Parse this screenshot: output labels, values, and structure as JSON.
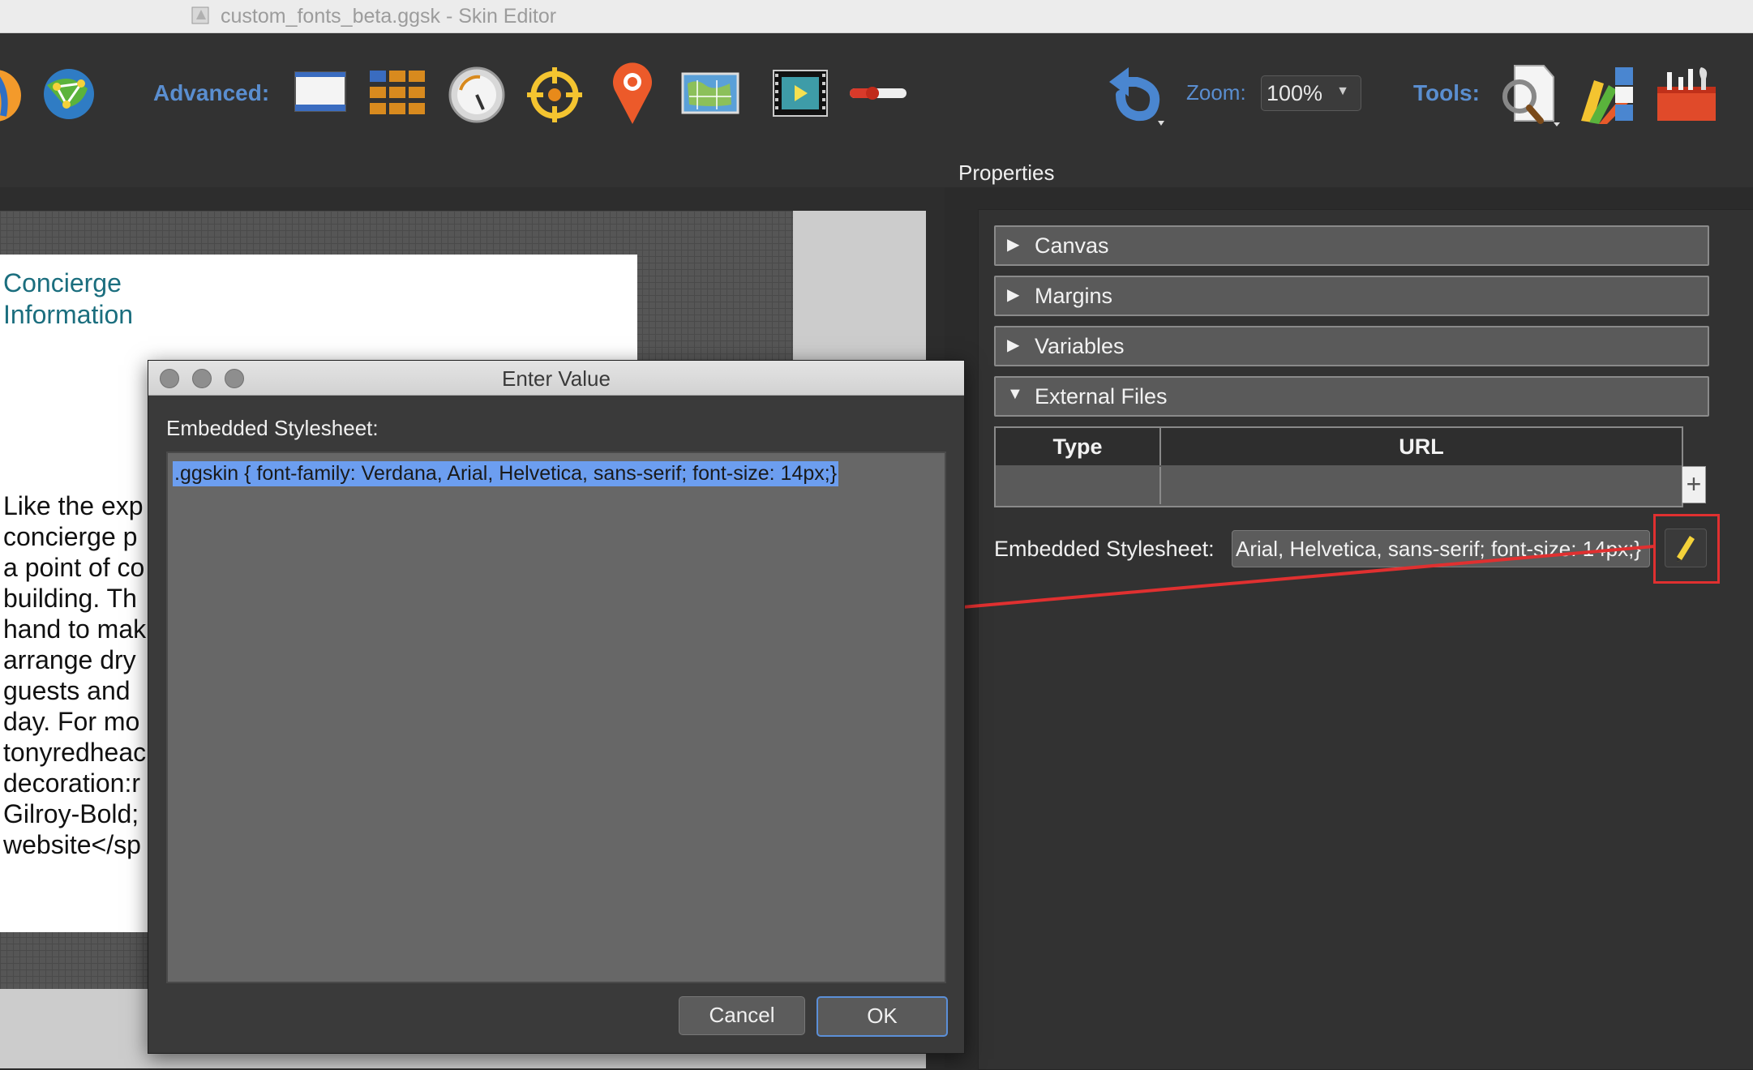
{
  "window": {
    "title": "custom_fonts_beta.ggsk - Skin Editor"
  },
  "toolbar": {
    "advanced_label": "Advanced:",
    "zoom_label": "Zoom:",
    "zoom_value": "100%",
    "tools_label": "Tools:",
    "icons": [
      "globe-icon",
      "network-globe-icon",
      "screen-layout-icon",
      "grid-icon",
      "dial-icon",
      "crosshair-icon",
      "map-pin-icon",
      "map-image-icon",
      "video-player-icon",
      "slider-icon",
      "undo-icon",
      "search-document-icon",
      "color-swatches-icon",
      "toolbox-icon"
    ]
  },
  "canvas": {
    "heading": "Concierge\nInformation",
    "body_lines": [
      "Like the exp",
      "concierge p",
      "a point of co",
      "building. Th",
      "hand to mak",
      "arrange dry",
      "guests and ",
      "day. For mo",
      "tonyredheac",
      "decoration:r",
      "Gilroy-Bold;",
      "website</sp"
    ]
  },
  "properties": {
    "title": "Properties",
    "sections": [
      {
        "label": "Canvas",
        "expanded": false
      },
      {
        "label": "Margins",
        "expanded": false
      },
      {
        "label": "Variables",
        "expanded": false
      },
      {
        "label": "External Files",
        "expanded": true
      }
    ],
    "external_files": {
      "col_type": "Type",
      "col_url": "URL",
      "add_label": "+"
    },
    "embedded_stylesheet": {
      "label": "Embedded Stylesheet:",
      "value": "Arial, Helvetica, sans-serif; font-size: 14px;}"
    }
  },
  "dialog": {
    "title": "Enter Value",
    "label": "Embedded Stylesheet:",
    "text": ".ggskin { font-family: Verdana, Arial, Helvetica, sans-serif; font-size: 14px;}",
    "cancel_label": "Cancel",
    "ok_label": "OK"
  },
  "colors": {
    "accent_blue": "#5a8ed0",
    "highlight_red": "#e03030",
    "selection": "#6c9ef0"
  }
}
